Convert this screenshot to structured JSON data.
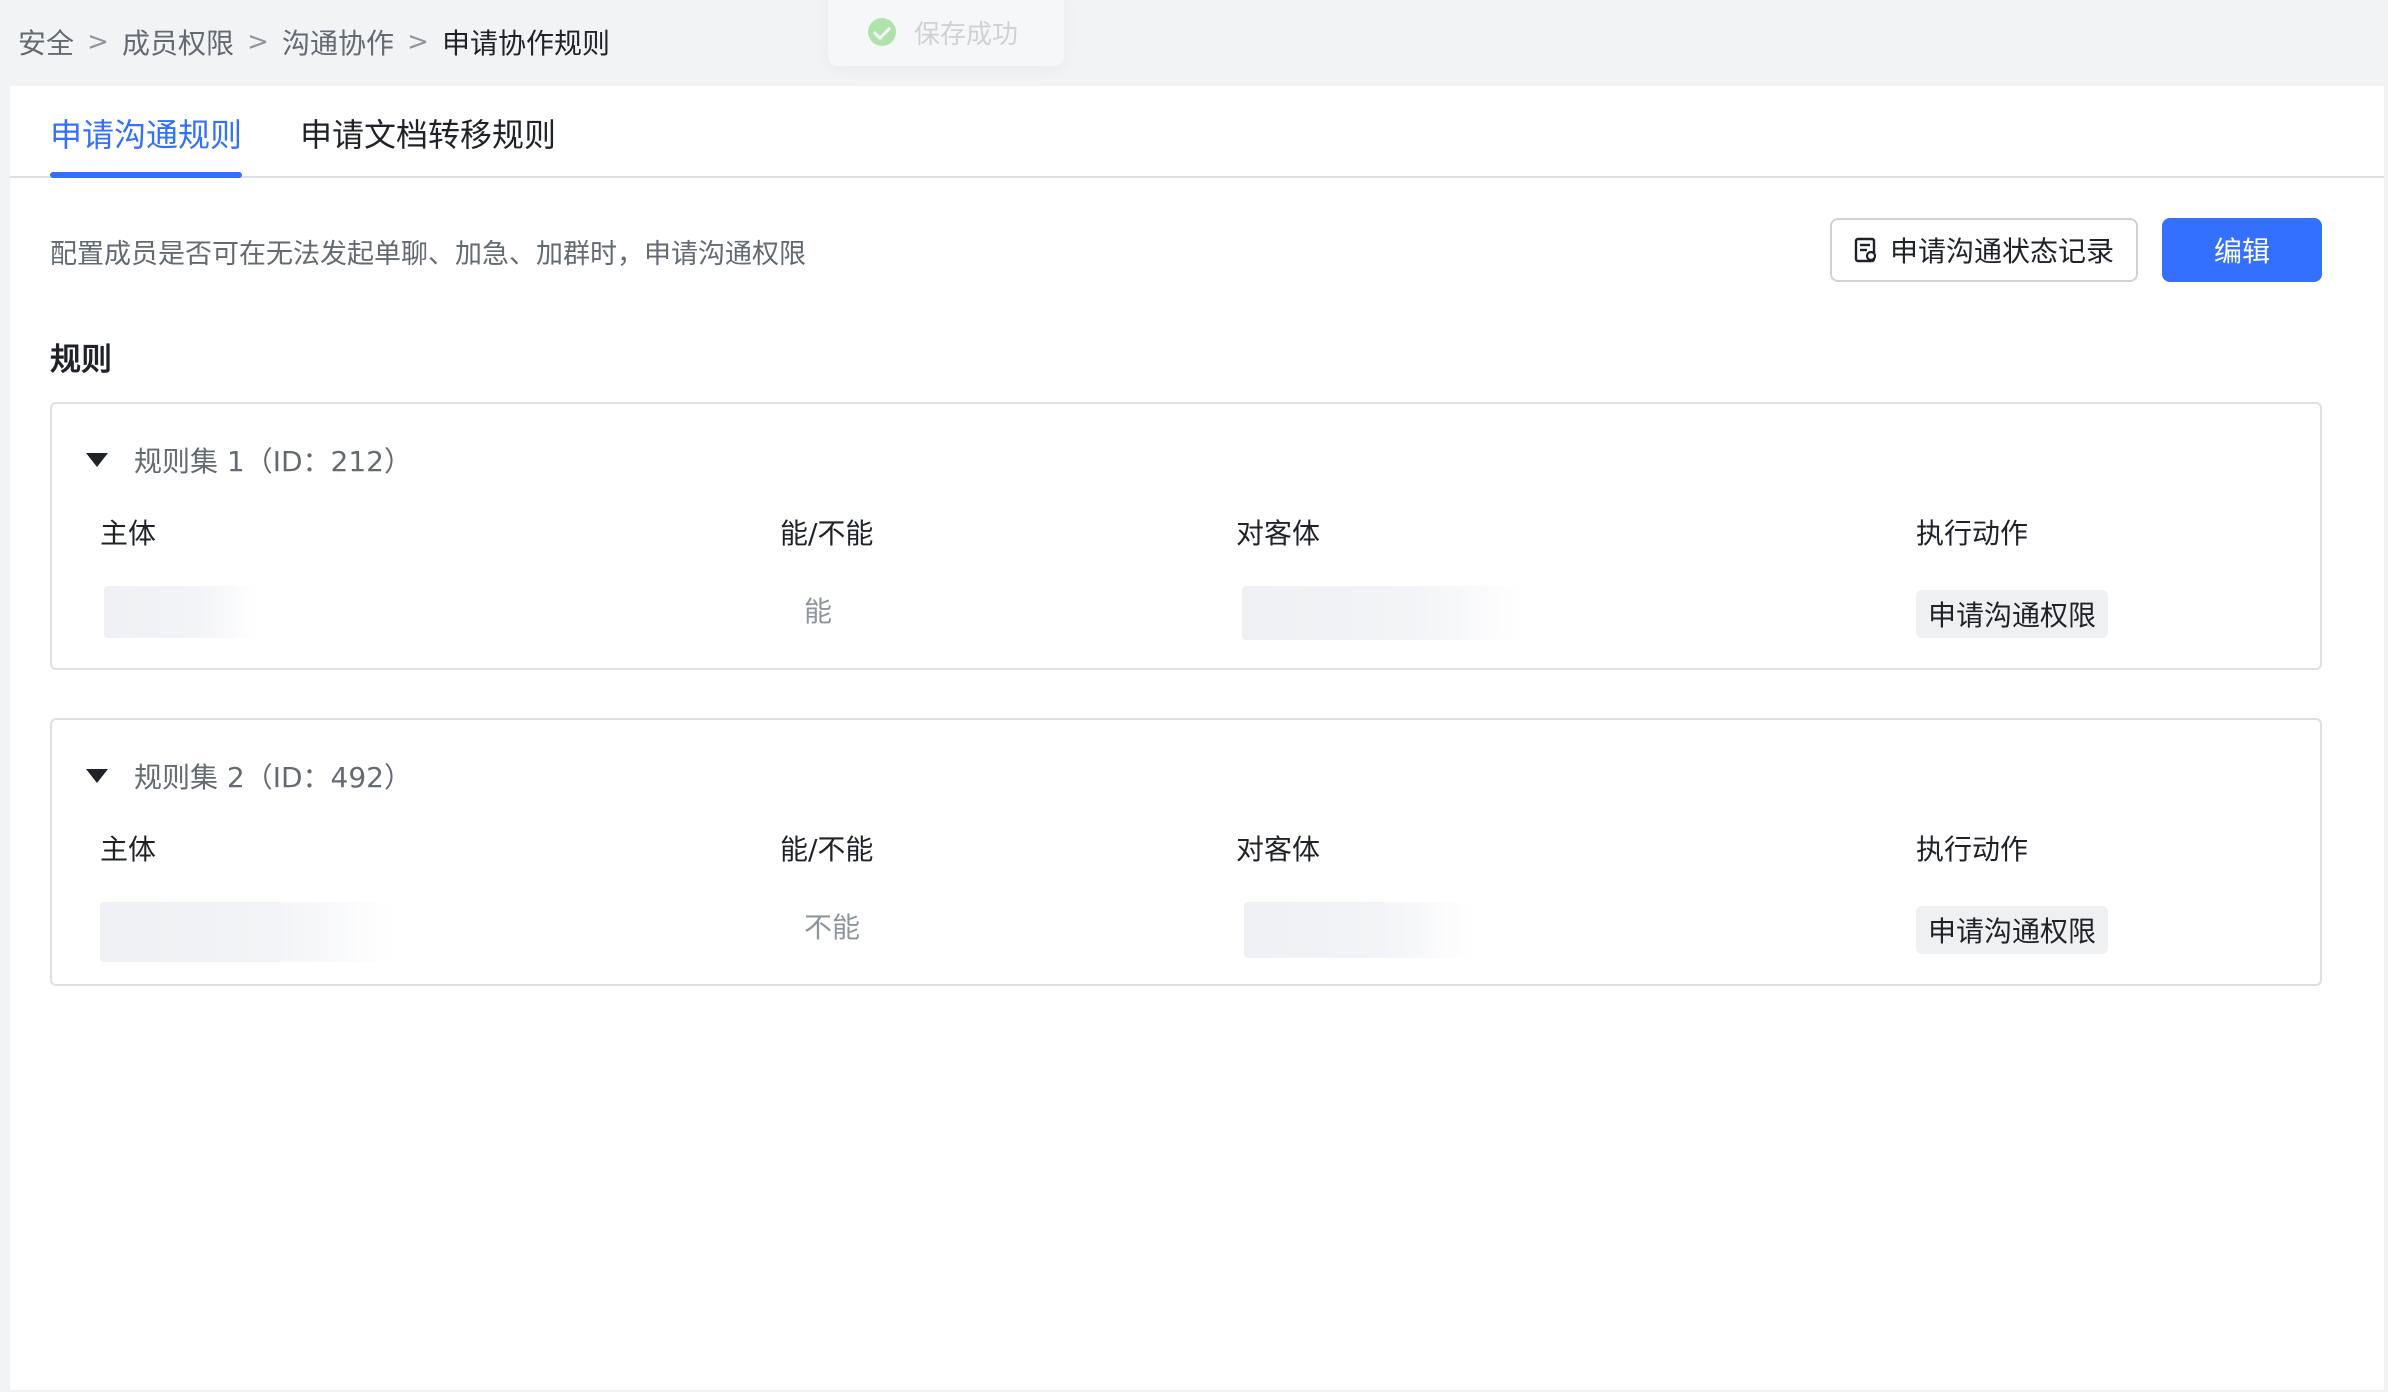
{
  "breadcrumb": {
    "items": [
      "安全",
      "成员权限",
      "沟通协作",
      "申请协作规则"
    ],
    "separator": ">"
  },
  "toast": {
    "text": "保存成功"
  },
  "tabs": [
    {
      "label": "申请沟通规则",
      "active": true
    },
    {
      "label": "申请文档转移规则",
      "active": false
    }
  ],
  "description": "配置成员是否可在无法发起单聊、加急、加群时，申请沟通权限",
  "buttons": {
    "log_label": "申请沟通状态记录",
    "edit_label": "编辑"
  },
  "section_title": "规则",
  "columns": [
    "主体",
    "能/不能",
    "对客体",
    "执行动作"
  ],
  "rulesets": [
    {
      "title": "规则集 1（ID：212）",
      "can": "能",
      "action": "申请沟通权限"
    },
    {
      "title": "规则集 2（ID：492）",
      "can": "不能",
      "action": "申请沟通权限"
    }
  ],
  "colors": {
    "accent": "#3370ff",
    "text": "#1f2329",
    "muted": "#646a73",
    "border": "#dee0e3"
  }
}
